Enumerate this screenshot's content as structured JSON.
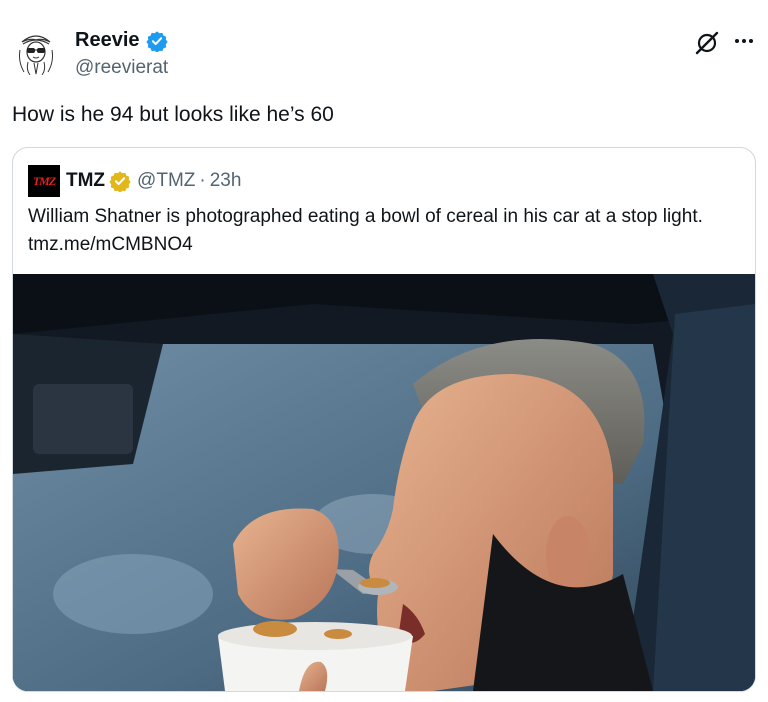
{
  "tweet": {
    "author_name": "Reevie",
    "author_handle": "@reevierat",
    "text": "How is he 94 but looks like he’s 60"
  },
  "quote": {
    "logo_text": "TMZ",
    "author_name": "TMZ",
    "author_handle": "@TMZ",
    "separator": "·",
    "time": "23h",
    "text": "William Shatner is photographed eating a bowl of cereal in his car at a stop light. tmz.me/mCMBNO4"
  },
  "icons": {
    "verified": "blue-verified-badge",
    "gold_verified": "gold-verified-badge",
    "grok": "grok-icon",
    "more": "more-dots-icon"
  },
  "colors": {
    "verified_blue": "#1d9bf0",
    "gold_badge": "#e2b719",
    "secondary_text": "#536471",
    "border": "#cfd9de"
  }
}
